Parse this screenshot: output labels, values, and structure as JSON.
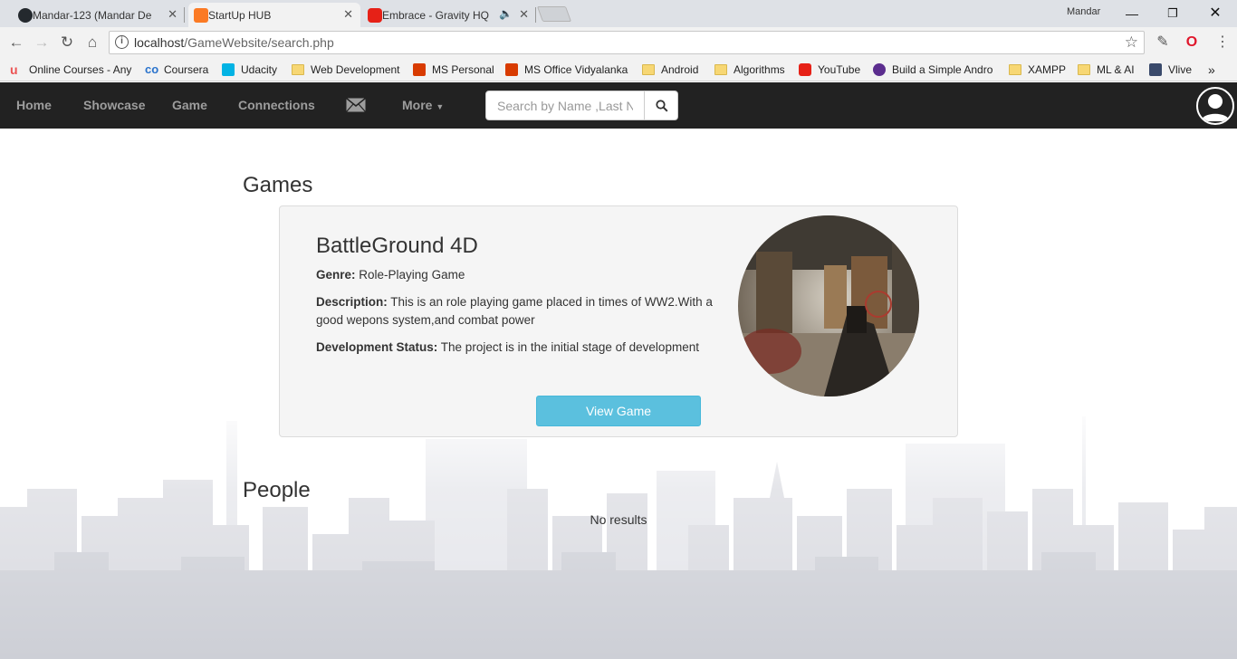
{
  "browser": {
    "tabs": [
      {
        "title": "Mandar-123 (Mandar De",
        "favicon": "github-icon",
        "active": false
      },
      {
        "title": "StartUp HUB",
        "favicon": "xampp-icon",
        "active": true
      },
      {
        "title": "Embrace - Gravity HQ",
        "favicon": "youtube-icon",
        "active": false
      }
    ],
    "profile_name": "Mandar",
    "url_host": "localhost",
    "url_path": "/GameWebsite/search.php",
    "bookmarks": [
      {
        "label": "Online Courses - Any",
        "icon": "udemy-icon"
      },
      {
        "label": "Coursera",
        "icon": "coursera-icon"
      },
      {
        "label": "Udacity",
        "icon": "udacity-icon"
      },
      {
        "label": "Web Development",
        "icon": "folder-icon"
      },
      {
        "label": "MS Personal",
        "icon": "office-icon"
      },
      {
        "label": "MS Office Vidyalanka",
        "icon": "office-icon"
      },
      {
        "label": "Android",
        "icon": "folder-icon"
      },
      {
        "label": "Algorithms",
        "icon": "folder-icon"
      },
      {
        "label": "YouTube",
        "icon": "youtube-icon"
      },
      {
        "label": "Build a Simple Andro",
        "icon": "site-icon"
      },
      {
        "label": "XAMPP",
        "icon": "folder-icon"
      },
      {
        "label": "ML & AI",
        "icon": "folder-icon"
      },
      {
        "label": "Vlive",
        "icon": "vlive-icon"
      }
    ],
    "overflow": "»"
  },
  "navbar": {
    "links": [
      "Home",
      "Showcase",
      "Game",
      "Connections"
    ],
    "more_label": "More",
    "search_placeholder": "Search by Name ,Last Name"
  },
  "games_section": {
    "heading": "Games",
    "game": {
      "name": "BattleGround 4D",
      "genre_label": "Genre:",
      "genre": "Role-Playing Game",
      "description_label": "Description:",
      "description": "This is an role playing game placed in times of WW2.With a good wepons system,and combat power",
      "status_label": "Development Status:",
      "status": "The project is in the initial stage of development",
      "button_label": "View Game"
    }
  },
  "people_section": {
    "heading": "People",
    "empty_text": "No results"
  },
  "colors": {
    "navbar_bg": "#222222",
    "nav_link": "#9d9d9d",
    "button_info": "#5bc0de"
  }
}
